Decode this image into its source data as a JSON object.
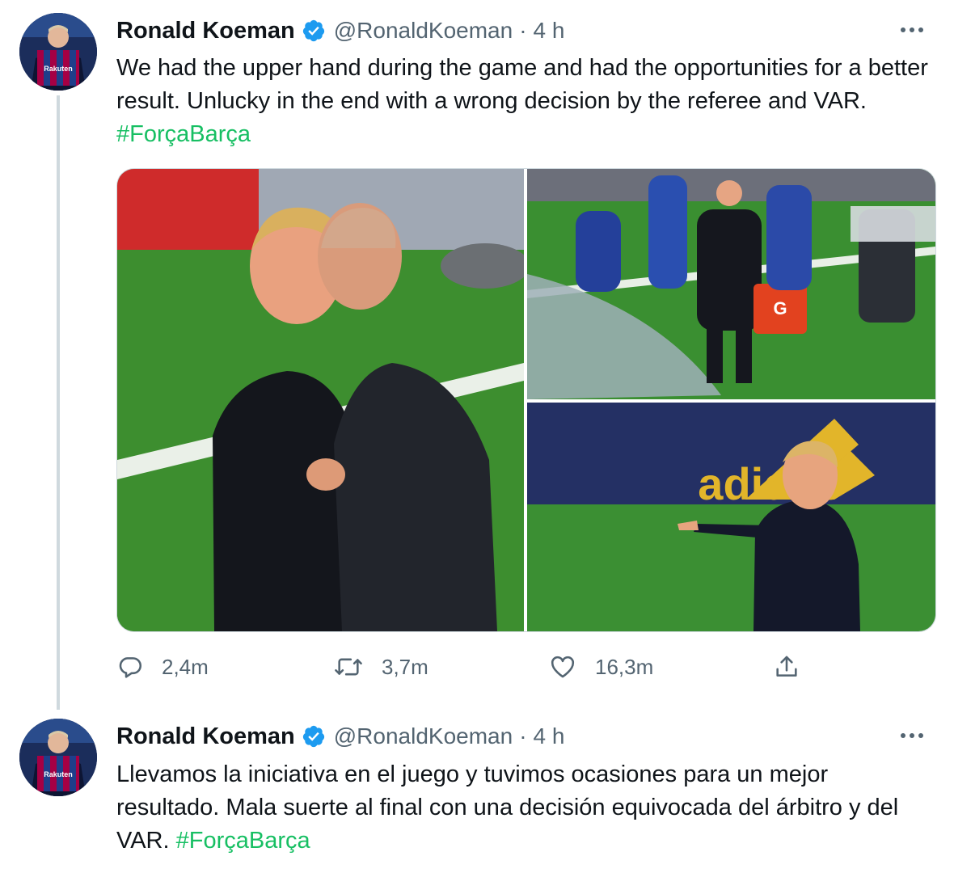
{
  "tweets": [
    {
      "author_name": "Ronald Koeman",
      "handle": "@RonaldKoeman",
      "separator": "·",
      "time": "4 h",
      "text": "We had the upper hand during the game and had the opportunities for a better result. Unlucky in the end with a wrong decision by the referee and VAR.",
      "hashtag": "#ForçaBarça",
      "media": [
        {
          "icon": "photo-koeman-zidane-handshake"
        },
        {
          "icon": "photo-koeman-on-sideline"
        },
        {
          "icon": "photo-koeman-pointing",
          "brand_text": "adidas"
        }
      ],
      "actions": {
        "reply_count": "2,4m",
        "retweet_count": "3,7m",
        "like_count": "16,3m"
      }
    },
    {
      "author_name": "Ronald Koeman",
      "handle": "@RonaldKoeman",
      "separator": "·",
      "time": "4 h",
      "text": "Llevamos la iniciativa en el juego y tuvimos ocasiones para un mejor resultado. Mala suerte al final con una decisión equivocada del árbitro y del VAR.",
      "hashtag": "#ForçaBarça"
    }
  ],
  "avatar_jersey_text": "Rakuten",
  "icons": {
    "verified": "verified-badge-icon",
    "more": "more-options-icon",
    "reply": "reply-icon",
    "retweet": "retweet-icon",
    "like": "like-icon",
    "share": "share-icon"
  },
  "colors": {
    "hashtag": "#17bf63",
    "verified": "#1d9bf0",
    "secondary_text": "#536471",
    "thread_line": "#cfd9de"
  }
}
